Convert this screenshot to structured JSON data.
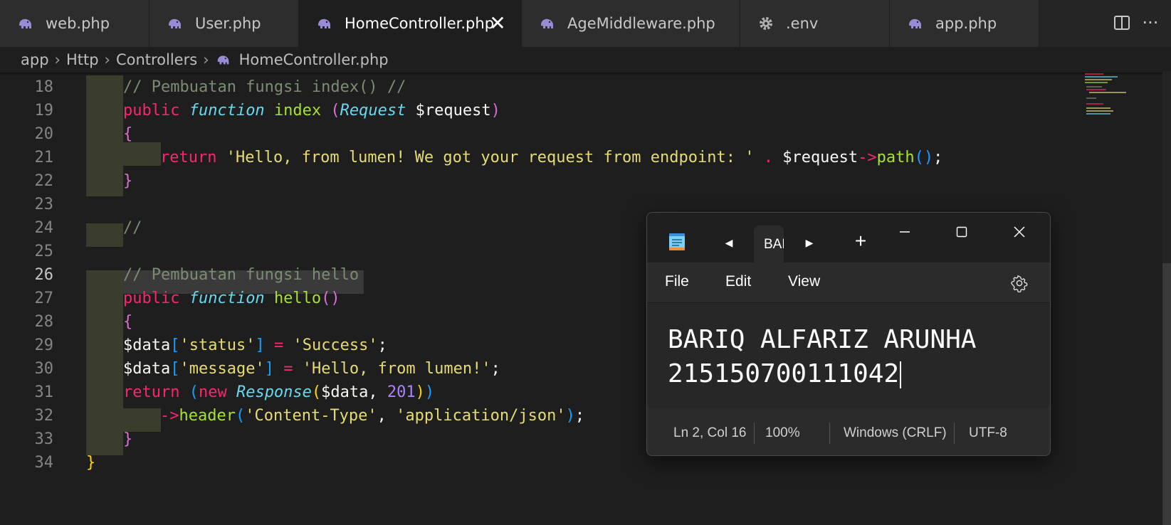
{
  "tabs": [
    {
      "label": "web.php",
      "icon": "php-elephant-icon",
      "active": false
    },
    {
      "label": "User.php",
      "icon": "php-elephant-icon",
      "active": false
    },
    {
      "label": "HomeController.php",
      "icon": "php-elephant-icon",
      "active": true
    },
    {
      "label": "AgeMiddleware.php",
      "icon": "php-elephant-icon",
      "active": false
    },
    {
      "label": ".env",
      "icon": "gear-icon",
      "active": false
    },
    {
      "label": "app.php",
      "icon": "php-elephant-icon",
      "active": false
    }
  ],
  "tab_actions": {
    "split_icon": "split-editor-icon",
    "more_icon": "more-actions-icon"
  },
  "breadcrumb": {
    "items": [
      "app",
      "Http",
      "Controllers"
    ],
    "file": "HomeController.php"
  },
  "editor": {
    "current_line": 26,
    "lines": [
      {
        "n": 18,
        "tokens": [
          [
            "c-cm",
            "// Pembuatan fungsi index() //"
          ]
        ]
      },
      {
        "n": 19,
        "tokens": [
          [
            "c-kw",
            "public "
          ],
          [
            "c-st",
            "function "
          ],
          [
            "c-fn",
            "index "
          ],
          [
            "c-br2",
            "("
          ],
          [
            "c-st",
            "Request "
          ],
          [
            "c-var",
            "$request"
          ],
          [
            "c-br2",
            ")"
          ]
        ]
      },
      {
        "n": 20,
        "tokens": [
          [
            "c-br2",
            "{"
          ]
        ]
      },
      {
        "n": 21,
        "tokens": [
          [
            "c-kw",
            "return "
          ],
          [
            "c-str",
            "'Hello, from lumen! We got your request from endpoint: ' "
          ],
          [
            "c-op",
            ". "
          ],
          [
            "c-var",
            "$request"
          ],
          [
            "c-op",
            "->"
          ],
          [
            "c-fn",
            "path"
          ],
          [
            "c-br3",
            "()"
          ],
          [
            "c-pl",
            ";"
          ]
        ]
      },
      {
        "n": 22,
        "tokens": [
          [
            "c-br2",
            "}"
          ]
        ]
      },
      {
        "n": 23,
        "tokens": []
      },
      {
        "n": 24,
        "tokens": [
          [
            "c-cm",
            "//"
          ]
        ]
      },
      {
        "n": 25,
        "tokens": []
      },
      {
        "n": 26,
        "tokens": [
          [
            "c-cm",
            "// Pembuatan fungsi hello"
          ]
        ]
      },
      {
        "n": 27,
        "tokens": [
          [
            "c-kw",
            "public "
          ],
          [
            "c-st",
            "function "
          ],
          [
            "c-fn",
            "hello"
          ],
          [
            "c-br2",
            "()"
          ]
        ]
      },
      {
        "n": 28,
        "tokens": [
          [
            "c-br2",
            "{"
          ]
        ]
      },
      {
        "n": 29,
        "tokens": [
          [
            "c-var",
            "$data"
          ],
          [
            "c-br3",
            "["
          ],
          [
            "c-str",
            "'status'"
          ],
          [
            "c-br3",
            "]"
          ],
          [
            "c-op",
            " = "
          ],
          [
            "c-str",
            "'Success'"
          ],
          [
            "c-pl",
            ";"
          ]
        ]
      },
      {
        "n": 30,
        "tokens": [
          [
            "c-var",
            "$data"
          ],
          [
            "c-br3",
            "["
          ],
          [
            "c-str",
            "'message'"
          ],
          [
            "c-br3",
            "]"
          ],
          [
            "c-op",
            " = "
          ],
          [
            "c-str",
            "'Hello, from lumen!'"
          ],
          [
            "c-pl",
            ";"
          ]
        ]
      },
      {
        "n": 31,
        "tokens": [
          [
            "c-kw",
            "return "
          ],
          [
            "c-br3",
            "("
          ],
          [
            "c-kw",
            "new "
          ],
          [
            "c-st",
            "Response"
          ],
          [
            "c-br1",
            "("
          ],
          [
            "c-var",
            "$data"
          ],
          [
            "c-pl",
            ", "
          ],
          [
            "c-num",
            "201"
          ],
          [
            "c-br1",
            ")"
          ],
          [
            "c-br3",
            ")"
          ]
        ]
      },
      {
        "n": 32,
        "tokens": [
          [
            "c-op",
            "->"
          ],
          [
            "c-fn",
            "header"
          ],
          [
            "c-br3",
            "("
          ],
          [
            "c-str",
            "'Content-Type'"
          ],
          [
            "c-pl",
            ", "
          ],
          [
            "c-str",
            "'application/json'"
          ],
          [
            "c-br3",
            ")"
          ],
          [
            "c-pl",
            ";"
          ]
        ]
      },
      {
        "n": 33,
        "tokens": [
          [
            "c-br2",
            "}"
          ]
        ]
      },
      {
        "n": 34,
        "tokens": [
          [
            "c-br1",
            "}"
          ]
        ]
      }
    ]
  },
  "notepad": {
    "tab_label": "BARIQ ALFARIZ ARUNHA",
    "menu": [
      "File",
      "Edit",
      "View"
    ],
    "content": [
      "BARIQ ALFARIZ ARUNHA",
      "215150700111042"
    ],
    "status": {
      "position": "Ln 2, Col 16",
      "zoom": "100%",
      "line_ending": "Windows (CRLF)",
      "encoding": "UTF-8"
    },
    "icons": {
      "app": "notepad-icon",
      "settings": "gear-icon"
    }
  }
}
